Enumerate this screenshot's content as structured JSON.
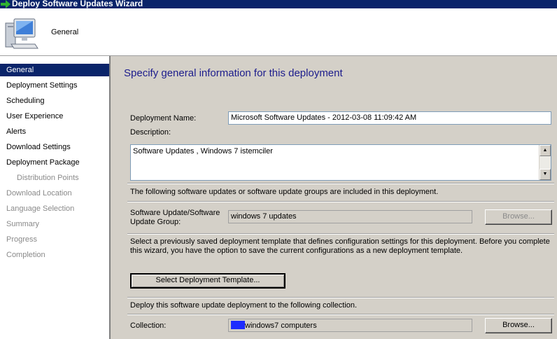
{
  "window": {
    "title": "Deploy Software Updates Wizard",
    "icon": "green-arrow-icon"
  },
  "header": {
    "title": "General",
    "icon": "computer-icon"
  },
  "sidebar": {
    "items": [
      {
        "label": "General",
        "state": "active"
      },
      {
        "label": "Deployment Settings",
        "state": "normal"
      },
      {
        "label": "Scheduling",
        "state": "normal"
      },
      {
        "label": "User Experience",
        "state": "normal"
      },
      {
        "label": "Alerts",
        "state": "normal"
      },
      {
        "label": "Download Settings",
        "state": "normal"
      },
      {
        "label": "Deployment Package",
        "state": "normal"
      },
      {
        "label": "Distribution Points",
        "state": "sub-dim"
      },
      {
        "label": "Download Location",
        "state": "dim"
      },
      {
        "label": "Language Selection",
        "state": "dim"
      },
      {
        "label": "Summary",
        "state": "dim"
      },
      {
        "label": "Progress",
        "state": "dim"
      },
      {
        "label": "Completion",
        "state": "dim"
      }
    ]
  },
  "main": {
    "heading": "Specify general information for this deployment",
    "deployment_name_label": "Deployment Name:",
    "deployment_name_value": "Microsoft Software Updates - 2012-03-08 11:09:42 AM",
    "description_label": "Description:",
    "description_value": "Software Updates , Windows 7 istemciler",
    "updates_info": "The following software updates or software update groups are included in this deployment.",
    "update_group_label_line1": "Software Update/Software",
    "update_group_label_line2": "Update Group:",
    "update_group_value": "windows 7 updates",
    "browse_disabled_label": "Browse...",
    "template_info": "Select a previously saved deployment template that defines configuration settings for this deployment. Before you complete this wizard, you have the option to save the current configurations as a new deployment template.",
    "select_template_button": "Select Deployment Template...",
    "collection_info": "Deploy this software update deployment to the following collection.",
    "collection_label": "Collection:",
    "collection_value": "windows7 computers",
    "browse_label": "Browse..."
  },
  "colors": {
    "accent": "#0a246a",
    "heading": "#1c1c8c",
    "redaction": "#1e2cff"
  }
}
